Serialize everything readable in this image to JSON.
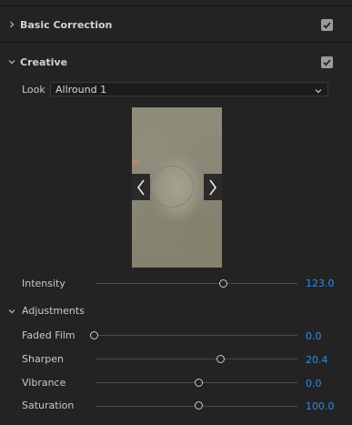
{
  "basic_correction": {
    "title": "Basic Correction",
    "enabled": true,
    "expanded": false
  },
  "creative": {
    "title": "Creative",
    "enabled": true,
    "expanded": true,
    "look": {
      "label": "Look",
      "value": "Allround 1"
    },
    "preview": {
      "prev_icon": "chevron-left-icon",
      "next_icon": "chevron-right-icon"
    },
    "intensity": {
      "label": "Intensity",
      "value": "123.0"
    },
    "adjustments": {
      "title": "Adjustments",
      "expanded": true,
      "rows": [
        {
          "label": "Faded Film",
          "value": "0.0"
        },
        {
          "label": "Sharpen",
          "value": "20.4"
        },
        {
          "label": "Vibrance",
          "value": "0.0"
        },
        {
          "label": "Saturation",
          "value": "100.0"
        }
      ]
    }
  },
  "colors": {
    "background": "#232323",
    "value_accent": "#2d8ceb",
    "checkbox": "#9b9b9b"
  }
}
